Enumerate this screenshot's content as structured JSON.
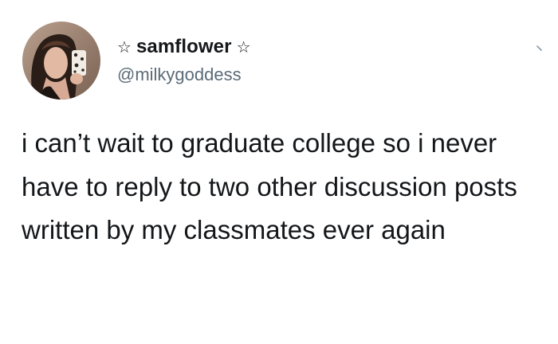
{
  "tweet": {
    "display_name": "samflower",
    "name_decoration_left": "☆",
    "name_decoration_right": "☆",
    "handle": "@milkygoddess",
    "text": "i can’t wait to graduate college so i never have to reply to two other discussion posts written by my classmates ever again"
  },
  "icons": {
    "avatar": "profile-photo",
    "menu": "chevron-down-icon"
  },
  "colors": {
    "text": "#14171a",
    "handle": "#5b6b78",
    "background": "#ffffff"
  }
}
